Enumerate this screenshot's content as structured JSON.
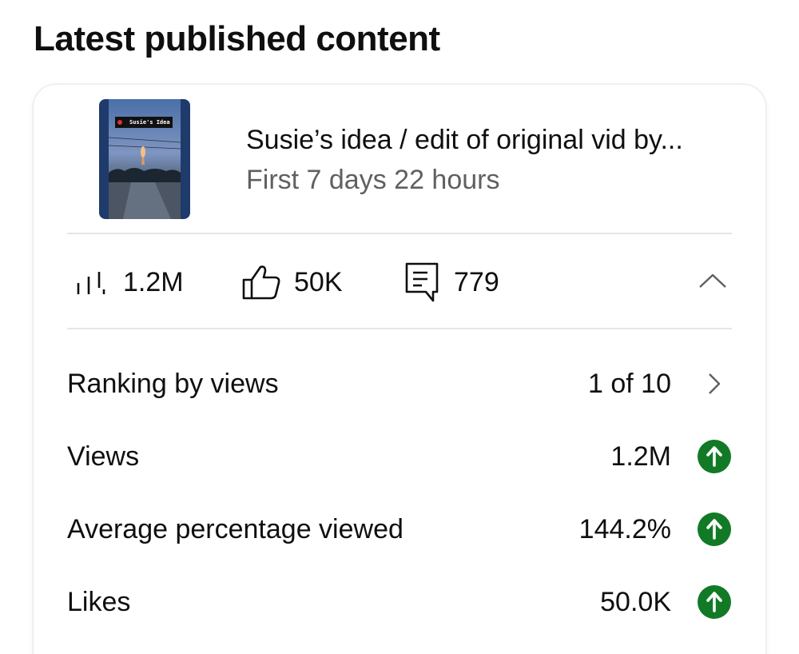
{
  "header": {
    "title": "Latest published content"
  },
  "video": {
    "thumbnail_caption": "Susie's Idea",
    "title": "Susie’s idea / edit of original vid by...",
    "period": "First 7 days 22 hours"
  },
  "stats": {
    "views": {
      "icon": "bar-chart-icon",
      "value": "1.2M"
    },
    "likes": {
      "icon": "thumbs-up-icon",
      "value": "50K"
    },
    "comments": {
      "icon": "comment-icon",
      "value": "779"
    },
    "collapse_icon": "chevron-up-icon"
  },
  "metrics": [
    {
      "label": "Ranking by views",
      "value": "1 of 10",
      "icon": "chevron-right-icon"
    },
    {
      "label": "Views",
      "value": "1.2M",
      "icon": "arrow-up-circle-icon"
    },
    {
      "label": "Average percentage viewed",
      "value": "144.2%",
      "icon": "arrow-up-circle-icon"
    },
    {
      "label": "Likes",
      "value": "50.0K",
      "icon": "arrow-up-circle-icon"
    }
  ],
  "colors": {
    "trend_up": "#127a27",
    "divider": "#e5e5e5",
    "secondary_text": "#606060"
  }
}
